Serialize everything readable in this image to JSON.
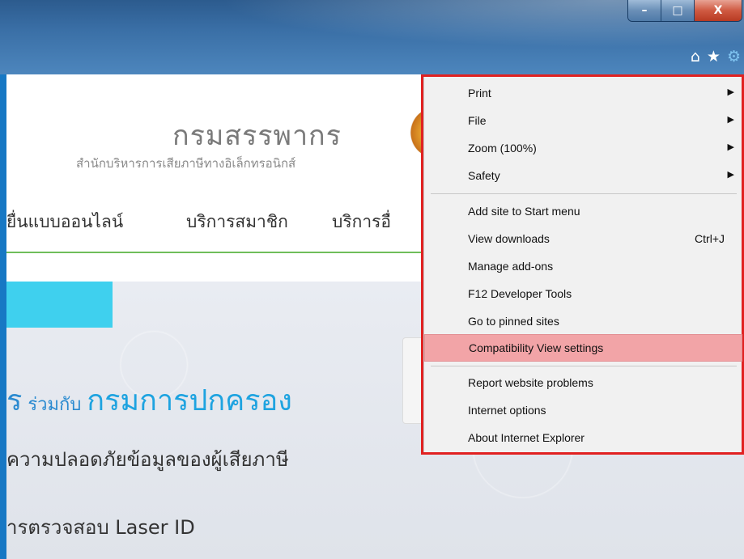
{
  "window": {
    "minimize_label": "–",
    "maximize_label": "□",
    "close_label": "X"
  },
  "icons": {
    "home": "⌂",
    "favorites": "★",
    "tools": "⚙"
  },
  "site": {
    "title": "กรมสรรพากร",
    "subtitle": "สำนักบริหารการเสียภาษีทางอิเล็กทรอนิกส์",
    "nav": [
      "ยื่นแบบออนไลน์",
      "บริการสมาชิก",
      "บริการอื่"
    ]
  },
  "hero": {
    "line1_prefix": "ร",
    "line1_small": " ร่วมกับ ",
    "line1_big": "กรมการปกครอง",
    "line2": "ความปลอดภัยข้อมูลของผู้เสียภาษี",
    "line3": "ารตรวจสอบ Laser ID",
    "next_arrow": "›"
  },
  "tools_menu": {
    "items": [
      {
        "label": "Print",
        "submenu": true
      },
      {
        "label": "File",
        "submenu": true
      },
      {
        "label": "Zoom (100%)",
        "submenu": true
      },
      {
        "label": "Safety",
        "submenu": true
      },
      {
        "label": "Add site to Start menu"
      },
      {
        "label": "View downloads",
        "shortcut": "Ctrl+J"
      },
      {
        "label": "Manage add-ons"
      },
      {
        "label": "F12 Developer Tools"
      },
      {
        "label": "Go to pinned sites"
      },
      {
        "label": "Compatibility View settings",
        "highlighted": true
      },
      {
        "label": "Report website problems"
      },
      {
        "label": "Internet options"
      },
      {
        "label": "About Internet Explorer"
      }
    ],
    "submenu_arrow": "▶"
  },
  "colors": {
    "highlight_border": "#e12121",
    "highlight_item": "#f2a4a7",
    "accent_blue": "#1778c4"
  }
}
